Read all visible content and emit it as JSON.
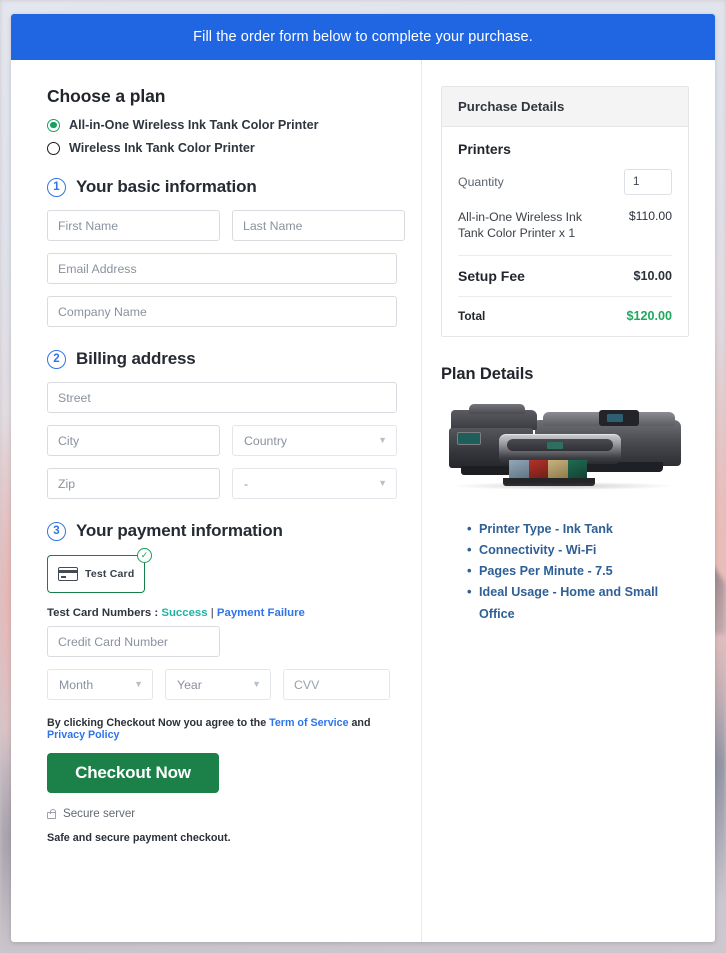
{
  "banner": {
    "text": "Fill the order form below to complete your purchase."
  },
  "plan": {
    "title": "Choose a plan",
    "options": [
      {
        "label": "All-in-One Wireless Ink Tank Color Printer",
        "selected": true
      },
      {
        "label": "Wireless Ink Tank Color Printer",
        "selected": false
      }
    ]
  },
  "steps": {
    "basic": {
      "number": "1",
      "title": "Your basic information"
    },
    "billing": {
      "number": "2",
      "title": "Billing address"
    },
    "payment": {
      "number": "3",
      "title": "Your payment information"
    }
  },
  "basic_fields": {
    "first_name": {
      "placeholder": "First Name",
      "value": ""
    },
    "last_name": {
      "placeholder": "Last Name",
      "value": ""
    },
    "email": {
      "placeholder": "Email Address",
      "value": ""
    },
    "company": {
      "placeholder": "Company Name",
      "value": ""
    }
  },
  "billing_fields": {
    "street": {
      "placeholder": "Street",
      "value": ""
    },
    "city": {
      "placeholder": "City",
      "value": ""
    },
    "country": {
      "selected": "Country"
    },
    "zip": {
      "placeholder": "Zip",
      "value": ""
    },
    "state": {
      "selected": "-"
    }
  },
  "payment": {
    "card_option_label": "Test  Card",
    "card_option_selected": true,
    "check_badge": "✓",
    "test_prefix": "Test Card Numbers : ",
    "link_success": "Success",
    "separator": " | ",
    "link_failure": "Payment Failure",
    "card_number": {
      "placeholder": "Credit Card Number",
      "value": ""
    },
    "month": {
      "selected": "Month"
    },
    "year": {
      "selected": "Year"
    },
    "cvv": {
      "placeholder": "CVV",
      "value": ""
    },
    "agree_prefix": "By clicking Checkout Now you agree to the ",
    "agree_tos": "Term of Service",
    "agree_and": " and ",
    "agree_privacy": "Privacy Policy",
    "checkout_label": "Checkout Now",
    "secure_server": "Secure server",
    "safe_note": "Safe and secure payment checkout."
  },
  "purchase": {
    "header": "Purchase Details",
    "group_title": "Printers",
    "quantity_label": "Quantity",
    "quantity_value": "1",
    "line_item_name": "All-in-One Wireless Ink Tank Color Printer x 1",
    "line_item_amount": "$110.00",
    "setup_fee_label": "Setup Fee",
    "setup_fee_amount": "$10.00",
    "total_label": "Total",
    "total_amount": "$120.00"
  },
  "plan_details": {
    "title": "Plan Details",
    "features": [
      "Printer Type - Ink Tank",
      "Connectivity - Wi-Fi",
      "Pages Per Minute - 7.5",
      "Ideal Usage - Home and Small Office"
    ]
  },
  "colors": {
    "banner_blue": "#2066e2",
    "accent_green": "#1c8049",
    "total_green": "#1fa85c",
    "link_blue": "#2f74e8",
    "link_teal": "#1cb3a5",
    "feature_blue": "#2e5f96"
  }
}
